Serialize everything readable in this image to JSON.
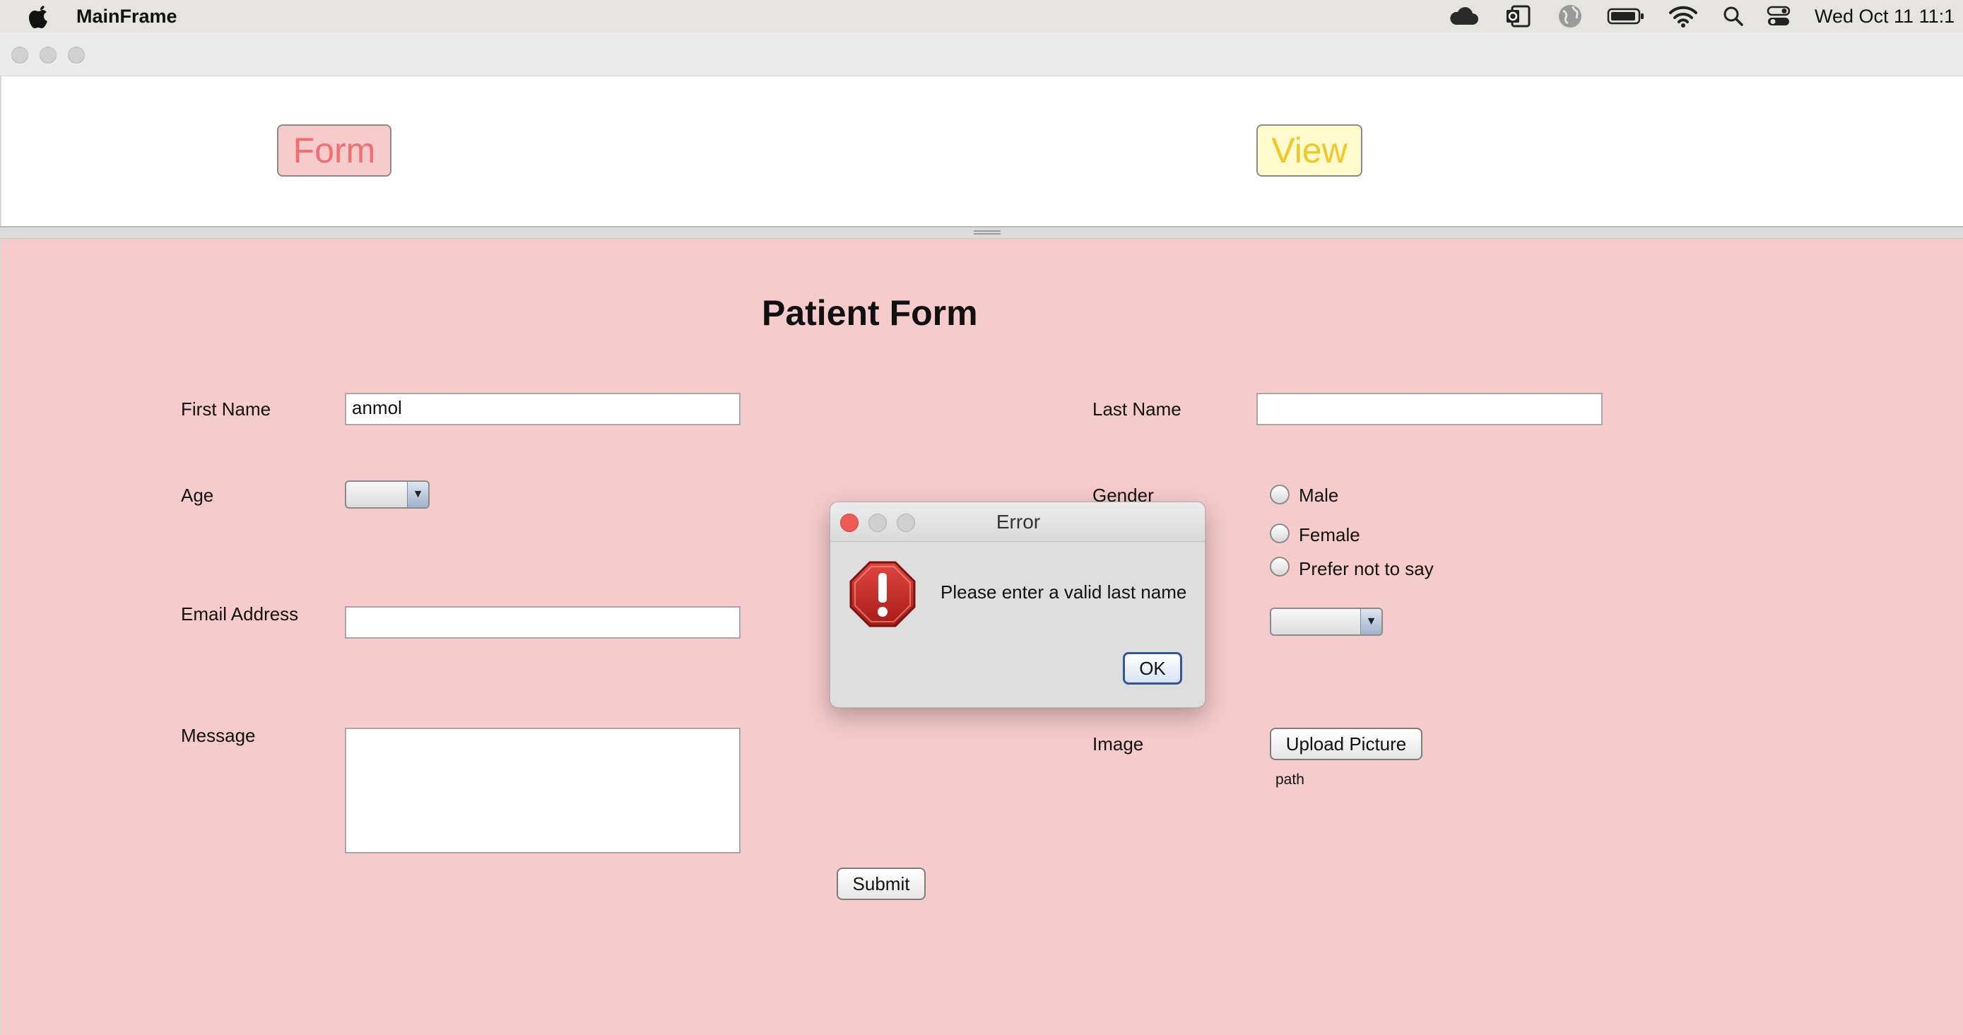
{
  "menubar": {
    "app_name": "MainFrame",
    "clock": "Wed Oct 11  11:1",
    "icons": [
      "apple-icon",
      "cloud-icon",
      "outlook-icon",
      "globe-icon",
      "battery-icon",
      "wifi-icon",
      "search-icon",
      "control-center-icon"
    ]
  },
  "nav": {
    "form_label": "Form",
    "view_label": "View"
  },
  "form": {
    "title": "Patient Form",
    "first_name_label": "First Name",
    "first_name_value": "anmol",
    "last_name_label": "Last Name",
    "last_name_value": "",
    "age_label": "Age",
    "gender_label": "Gender",
    "gender_options": [
      "Male",
      "Female",
      "Prefer not to say"
    ],
    "email_label": "Email Address",
    "email_value": "",
    "message_label": "Message",
    "message_value": "",
    "image_label": "Image",
    "upload_button": "Upload Picture",
    "path_label": "path",
    "submit_button": "Submit"
  },
  "dialog": {
    "title": "Error",
    "message": "Please enter a valid last name",
    "ok_button": "OK",
    "icon": "error-stop-icon"
  },
  "colors": {
    "form_bg": "#f6cbcc",
    "form_nav_text": "#ef6f73",
    "view_nav_bg": "#fffbcc",
    "view_nav_text": "#f0c628",
    "close_red": "#ee5b55"
  }
}
